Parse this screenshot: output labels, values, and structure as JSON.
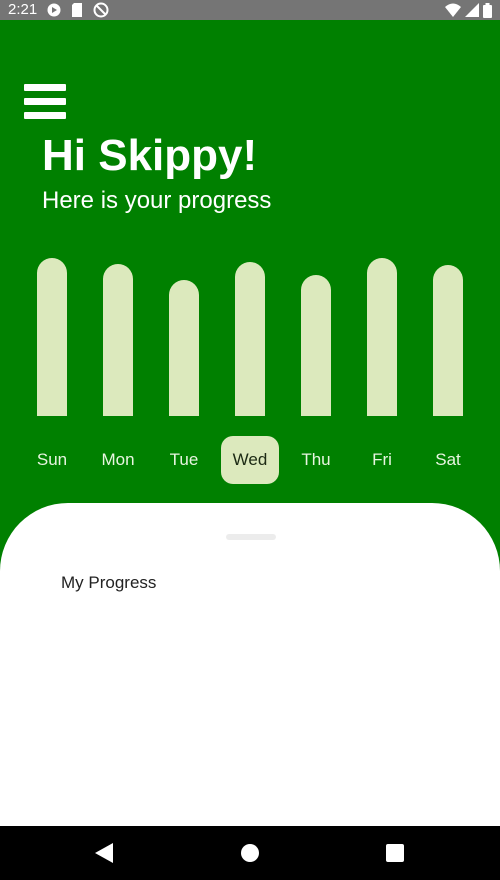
{
  "status_bar": {
    "time": "2:21",
    "left_icons": [
      "play-store-icon",
      "sd-card-icon",
      "do-not-disturb-icon"
    ],
    "right_icons": [
      "wifi-icon",
      "cellular-signal-icon",
      "battery-icon"
    ]
  },
  "header": {
    "greeting": "Hi Skippy!",
    "subtitle": "Here is your progress"
  },
  "chart_data": {
    "type": "bar",
    "categories": [
      "Sun",
      "Mon",
      "Tue",
      "Wed",
      "Thu",
      "Fri",
      "Sat"
    ],
    "values": [
      158,
      152,
      136,
      154,
      141,
      158,
      151
    ],
    "selected_category": "Wed",
    "title": "",
    "xlabel": "",
    "ylabel": "",
    "grid": false
  },
  "sheet": {
    "title": "My Progress"
  },
  "navigation": {
    "buttons": [
      "back-icon",
      "home-icon",
      "recents-icon"
    ]
  },
  "colors": {
    "primary": "#008000",
    "bar": "#dce9bd",
    "status_bar": "#757575",
    "nav_bar": "#000000"
  }
}
